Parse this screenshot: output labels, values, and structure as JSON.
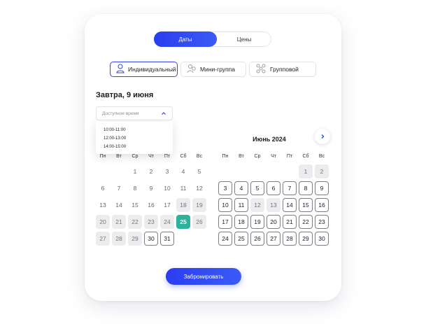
{
  "tabs": {
    "dates": "Даты",
    "prices": "Цены",
    "active": "dates"
  },
  "types": [
    {
      "label": "Индивидуальный",
      "icon": "person-icon",
      "selected": true
    },
    {
      "label": "Мини-группа",
      "icon": "two-people-icon",
      "selected": false
    },
    {
      "label": "Групповой",
      "icon": "group-icon",
      "selected": false
    }
  ],
  "date_title": "Завтра, 9 июня",
  "time_select": {
    "placeholder": "Доступное время",
    "options": [
      "10:00-11:00",
      "12:00-13:00",
      "14:00-15:00"
    ]
  },
  "weekdays": [
    "Пн",
    "Вт",
    "Ср",
    "Чт",
    "Пт",
    "Сб",
    "Вс"
  ],
  "left_month": {
    "days": [
      {
        "d": "1",
        "s": "plain"
      },
      {
        "d": "2",
        "s": "plain"
      },
      {
        "d": "3",
        "s": "plain"
      },
      {
        "d": "4",
        "s": "plain"
      },
      {
        "d": "5",
        "s": "plain"
      },
      {
        "d": "6",
        "s": "plain"
      },
      {
        "d": "7",
        "s": "plain"
      },
      {
        "d": "8",
        "s": "plain"
      },
      {
        "d": "9",
        "s": "plain"
      },
      {
        "d": "10",
        "s": "plain"
      },
      {
        "d": "11",
        "s": "plain"
      },
      {
        "d": "12",
        "s": "plain"
      },
      {
        "d": "13",
        "s": "plain"
      },
      {
        "d": "14",
        "s": "plain"
      },
      {
        "d": "15",
        "s": "plain"
      },
      {
        "d": "16",
        "s": "plain"
      },
      {
        "d": "17",
        "s": "plain"
      },
      {
        "d": "18",
        "s": "unavail"
      },
      {
        "d": "19",
        "s": "unavail"
      },
      {
        "d": "20",
        "s": "unavail"
      },
      {
        "d": "21",
        "s": "unavail"
      },
      {
        "d": "22",
        "s": "unavail"
      },
      {
        "d": "23",
        "s": "unavail"
      },
      {
        "d": "24",
        "s": "unavail"
      },
      {
        "d": "25",
        "s": "sel"
      },
      {
        "d": "26",
        "s": "unavail"
      },
      {
        "d": "27",
        "s": "unavail"
      },
      {
        "d": "28",
        "s": "unavail"
      },
      {
        "d": "29",
        "s": "unavail"
      },
      {
        "d": "30",
        "s": "avail"
      },
      {
        "d": "31",
        "s": "avail"
      }
    ]
  },
  "right_month": {
    "title": "Июнь 2024",
    "days": [
      {
        "d": "1",
        "s": "unavail"
      },
      {
        "d": "2",
        "s": "unavail"
      },
      {
        "d": "3",
        "s": "avail"
      },
      {
        "d": "4",
        "s": "avail"
      },
      {
        "d": "5",
        "s": "avail"
      },
      {
        "d": "6",
        "s": "avail"
      },
      {
        "d": "7",
        "s": "avail"
      },
      {
        "d": "8",
        "s": "avail"
      },
      {
        "d": "9",
        "s": "avail"
      },
      {
        "d": "10",
        "s": "avail"
      },
      {
        "d": "11",
        "s": "avail"
      },
      {
        "d": "12",
        "s": "unavail"
      },
      {
        "d": "13",
        "s": "unavail"
      },
      {
        "d": "14",
        "s": "avail"
      },
      {
        "d": "15",
        "s": "avail"
      },
      {
        "d": "16",
        "s": "avail"
      },
      {
        "d": "17",
        "s": "avail"
      },
      {
        "d": "18",
        "s": "avail"
      },
      {
        "d": "19",
        "s": "avail"
      },
      {
        "d": "20",
        "s": "avail"
      },
      {
        "d": "21",
        "s": "avail"
      },
      {
        "d": "22",
        "s": "avail"
      },
      {
        "d": "23",
        "s": "avail"
      },
      {
        "d": "24",
        "s": "avail"
      },
      {
        "d": "25",
        "s": "avail"
      },
      {
        "d": "26",
        "s": "avail"
      },
      {
        "d": "27",
        "s": "avail"
      },
      {
        "d": "28",
        "s": "avail"
      },
      {
        "d": "29",
        "s": "avail"
      },
      {
        "d": "30",
        "s": "avail"
      }
    ]
  },
  "book_button": "Забронировать",
  "colors": {
    "accent": "#3046e8",
    "selected_day": "#2bb39c",
    "unavailable": "#ececee"
  }
}
